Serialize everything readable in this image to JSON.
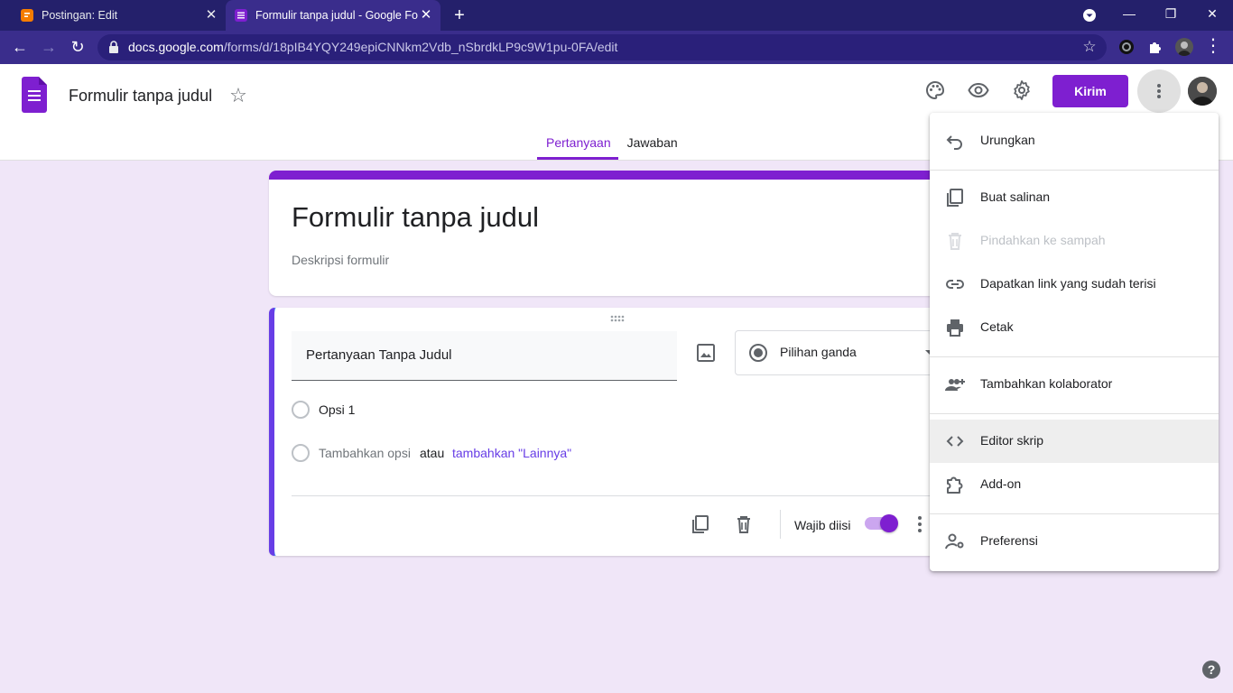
{
  "browser": {
    "tabs": [
      {
        "title": "Postingan: Edit",
        "favicon": "blogger-icon",
        "active": false
      },
      {
        "title": "Formulir tanpa judul - Google Fo",
        "favicon": "google-forms-icon",
        "active": true
      }
    ],
    "url_host": "docs.google.com",
    "url_path": "/forms/d/18pIB4YQY249epiCNNkm2Vdb_nSbrdkLP9c9W1pu-0FA/edit"
  },
  "header": {
    "doc_title": "Formulir tanpa judul",
    "send_label": "Kirim",
    "tabs": [
      {
        "label": "Pertanyaan",
        "active": true
      },
      {
        "label": "Jawaban",
        "active": false
      }
    ]
  },
  "form": {
    "title": "Formulir tanpa judul",
    "description_placeholder": "Deskripsi formulir"
  },
  "question": {
    "title": "Pertanyaan Tanpa Judul",
    "type": "Pilihan ganda",
    "option1": "Opsi 1",
    "add_option": "Tambahkan opsi",
    "or": "atau",
    "add_other": "tambahkan \"Lainnya\"",
    "required_label": "Wajib diisi",
    "required": true
  },
  "menu": {
    "items": [
      {
        "label": "Urungkan",
        "icon": "undo-icon",
        "disabled": false
      },
      {
        "label": "Buat salinan",
        "icon": "copy-icon",
        "disabled": false
      },
      {
        "label": "Pindahkan ke sampah",
        "icon": "trash-icon",
        "disabled": true
      },
      {
        "label": "Dapatkan link yang sudah terisi",
        "icon": "link-icon",
        "disabled": false
      },
      {
        "label": "Cetak",
        "icon": "print-icon",
        "disabled": false
      },
      {
        "label": "Tambahkan kolaborator",
        "icon": "add-people-icon",
        "disabled": false
      },
      {
        "label": "Editor skrip",
        "icon": "code-icon",
        "disabled": false,
        "highlighted": true
      },
      {
        "label": "Add-on",
        "icon": "puzzle-icon",
        "disabled": false
      },
      {
        "label": "Preferensi",
        "icon": "person-settings-icon",
        "disabled": false
      }
    ]
  },
  "colors": {
    "accent": "#7e1fd0",
    "background": "#f0e6f8",
    "browser_frame": "#24206b"
  }
}
